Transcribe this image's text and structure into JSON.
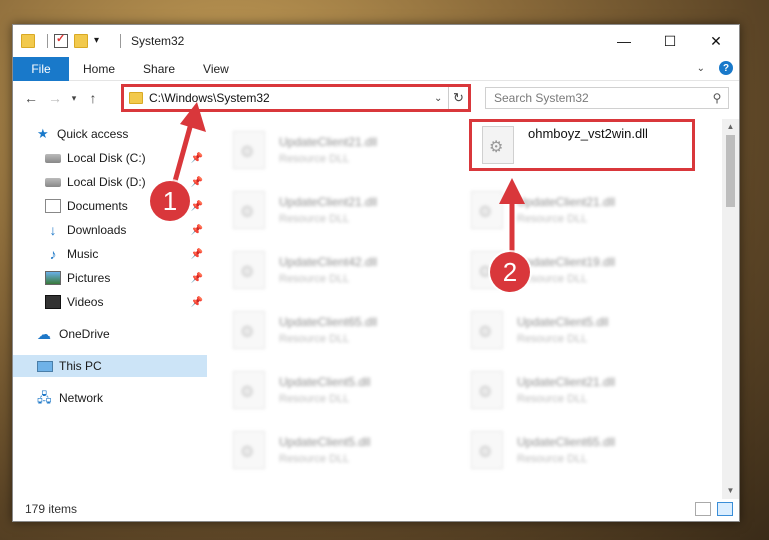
{
  "window": {
    "title": "System32"
  },
  "ribbon": {
    "tabs": [
      "File",
      "Home",
      "Share",
      "View"
    ],
    "help": "?"
  },
  "address": {
    "path": "C:\\Windows\\System32"
  },
  "search": {
    "placeholder": "Search System32"
  },
  "sidebar": {
    "items": [
      {
        "label": "Quick access",
        "icon": "star-icon"
      },
      {
        "label": "Local Disk (C:)",
        "icon": "disk-icon",
        "pinned": true
      },
      {
        "label": "Local Disk (D:)",
        "icon": "disk-icon",
        "pinned": true
      },
      {
        "label": "Documents",
        "icon": "document-icon",
        "pinned": true
      },
      {
        "label": "Downloads",
        "icon": "download-icon",
        "pinned": true
      },
      {
        "label": "Music",
        "icon": "music-icon",
        "pinned": true
      },
      {
        "label": "Pictures",
        "icon": "pictures-icon",
        "pinned": true
      },
      {
        "label": "Videos",
        "icon": "video-icon",
        "pinned": true
      },
      {
        "label": "OneDrive",
        "icon": "cloud-icon"
      },
      {
        "label": "This PC",
        "icon": "computer-icon",
        "selected": true
      },
      {
        "label": "Network",
        "icon": "network-icon"
      }
    ]
  },
  "files": {
    "highlighted": {
      "name": "ohmboyz_vst2win.dll"
    },
    "left": [
      {
        "name": "UpdateClient21.dll",
        "type": "Resource DLL"
      },
      {
        "name": "UpdateClient21.dll",
        "type": "Resource DLL"
      },
      {
        "name": "UpdateClient42.dll",
        "type": "Resource DLL"
      },
      {
        "name": "UpdateClient65.dll",
        "type": "Resource DLL"
      },
      {
        "name": "UpdateClient5.dll",
        "type": "Resource DLL"
      },
      {
        "name": "UpdateClient5.dll",
        "type": "Resource DLL"
      }
    ],
    "right": [
      {
        "name": "UpdateClient21.dll",
        "type": "Resource DLL"
      },
      {
        "name": "UpdateClient19.dll",
        "type": "Resource DLL"
      },
      {
        "name": "UpdateClient5.dll",
        "type": "Resource DLL"
      },
      {
        "name": "UpdateClient21.dll",
        "type": "Resource DLL"
      },
      {
        "name": "UpdateClient65.dll",
        "type": "Resource DLL"
      }
    ]
  },
  "status": {
    "count": "179 items"
  },
  "annotations": {
    "step1": "1",
    "step2": "2",
    "color": "#d9373b"
  }
}
